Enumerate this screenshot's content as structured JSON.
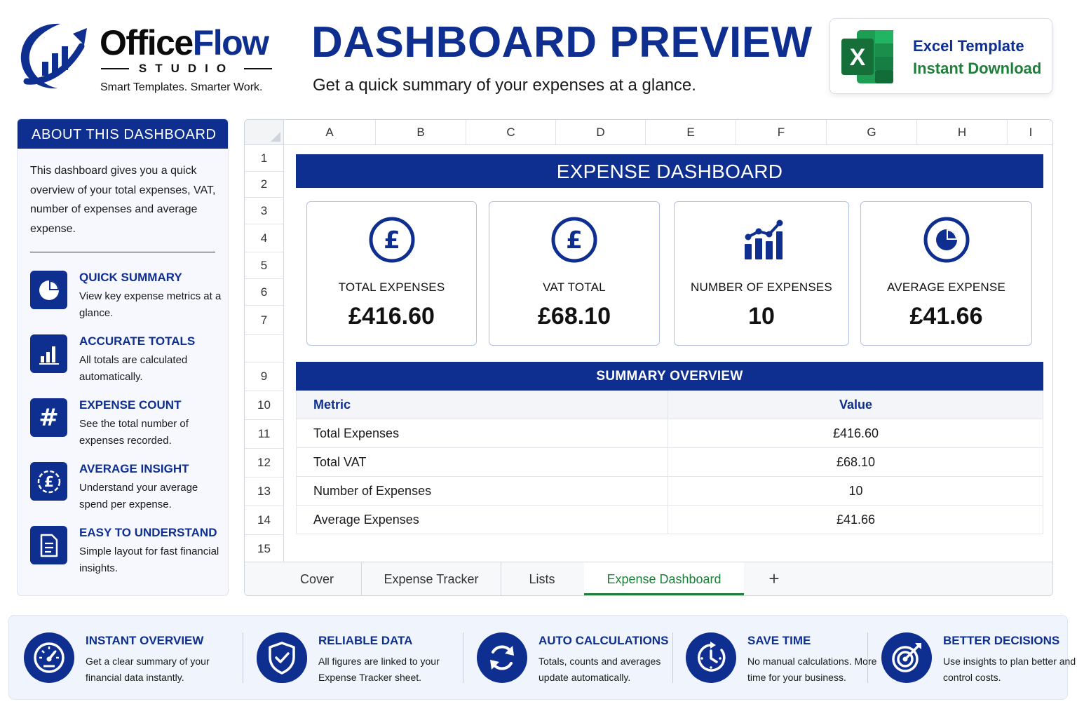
{
  "brand": {
    "name_part1": "Office",
    "name_part2": "Flow",
    "sub": "STUDIO",
    "tagline": "Smart Templates. Smarter Work."
  },
  "header": {
    "title": "DASHBOARD PREVIEW",
    "subtitle": "Get a quick summary of your expenses at a glance."
  },
  "template_card": {
    "line1": "Excel Template",
    "line2": "Instant Download",
    "icon_letter": "X"
  },
  "about": {
    "heading": "ABOUT THIS DASHBOARD",
    "intro": "This dashboard gives you a quick overview of your total expenses, VAT, number of expenses and average expense.",
    "features": [
      {
        "icon": "pie-chart-icon",
        "title": "QUICK SUMMARY",
        "desc": "View key expense metrics at a glance."
      },
      {
        "icon": "bar-chart-icon",
        "title": "ACCURATE TOTALS",
        "desc": "All totals are calculated automatically."
      },
      {
        "icon": "hash-icon",
        "title": "EXPENSE COUNT",
        "desc": "See the total number of expenses recorded."
      },
      {
        "icon": "pound-coin-icon",
        "title": "AVERAGE INSIGHT",
        "desc": "Understand your average spend per expense."
      },
      {
        "icon": "document-icon",
        "title": "EASY TO UNDERSTAND",
        "desc": "Simple layout for fast financial insights."
      }
    ]
  },
  "sheet": {
    "columns": [
      "A",
      "B",
      "C",
      "D",
      "E",
      "F",
      "G",
      "H",
      "I"
    ],
    "rows": [
      "1",
      "2",
      "3",
      "4",
      "5",
      "6",
      "7",
      "9",
      "10",
      "11",
      "12",
      "13",
      "14",
      "15"
    ],
    "banner": "EXPENSE DASHBOARD",
    "kpis": [
      {
        "icon": "pound-circle-icon",
        "label": "TOTAL EXPENSES",
        "value": "£416.60"
      },
      {
        "icon": "pound-circle-icon",
        "label": "VAT TOTAL",
        "value": "£68.10"
      },
      {
        "icon": "growth-chart-icon",
        "label": "NUMBER OF EXPENSES",
        "value": "10"
      },
      {
        "icon": "pie-circle-icon",
        "label": "AVERAGE EXPENSE",
        "value": "£41.66"
      }
    ],
    "summary": {
      "heading": "SUMMARY OVERVIEW",
      "col_metric": "Metric",
      "col_value": "Value",
      "rows": [
        {
          "metric": "Total Expenses",
          "value": "£416.60"
        },
        {
          "metric": "Total VAT",
          "value": "£68.10"
        },
        {
          "metric": "Number of Expenses",
          "value": "10"
        },
        {
          "metric": "Average Expenses",
          "value": "£41.66"
        }
      ]
    },
    "tabs": [
      "Cover",
      "Expense Tracker",
      "Lists",
      "Expense Dashboard"
    ],
    "active_tab": "Expense Dashboard",
    "add_tab": "+"
  },
  "benefits": [
    {
      "icon": "speedometer-icon",
      "title": "INSTANT OVERVIEW",
      "desc": "Get a clear summary of your financial data instantly."
    },
    {
      "icon": "shield-check-icon",
      "title": "RELIABLE DATA",
      "desc": "All figures are linked to your Expense Tracker sheet."
    },
    {
      "icon": "refresh-icon",
      "title": "AUTO CALCULATIONS",
      "desc": "Totals, counts and averages update automatically."
    },
    {
      "icon": "clock-icon",
      "title": "SAVE TIME",
      "desc": "No manual calculations. More time for your business."
    },
    {
      "icon": "target-icon",
      "title": "BETTER DECISIONS",
      "desc": "Use insights to plan better and control costs."
    }
  ],
  "colors": {
    "primary": "#0e2f8f",
    "accent_green": "#1e7f3a",
    "panel_bg": "#f6f8fd"
  }
}
